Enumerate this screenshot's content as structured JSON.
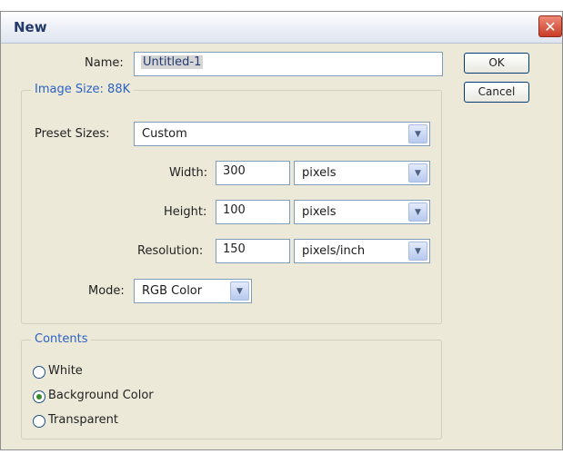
{
  "dialog": {
    "title": "New",
    "close_symbol": "✕"
  },
  "name": {
    "label": "Name:",
    "value": "Untitled-1"
  },
  "buttons": {
    "ok": "OK",
    "cancel": "Cancel"
  },
  "image_size": {
    "legend": "Image Size: 88K",
    "preset": {
      "label": "Preset Sizes:",
      "value": "Custom"
    },
    "width": {
      "label": "Width:",
      "value": "300",
      "unit": "pixels"
    },
    "height": {
      "label": "Height:",
      "value": "100",
      "unit": "pixels"
    },
    "resolution": {
      "label": "Resolution:",
      "value": "150",
      "unit": "pixels/inch"
    },
    "mode": {
      "label": "Mode:",
      "value": "RGB Color"
    }
  },
  "contents": {
    "legend": "Contents",
    "options": [
      {
        "label": "White",
        "selected": false
      },
      {
        "label": "Background Color",
        "selected": true
      },
      {
        "label": "Transparent",
        "selected": false
      }
    ]
  },
  "icons": {
    "dropdown": "chevron-down-icon",
    "close": "close-icon"
  }
}
